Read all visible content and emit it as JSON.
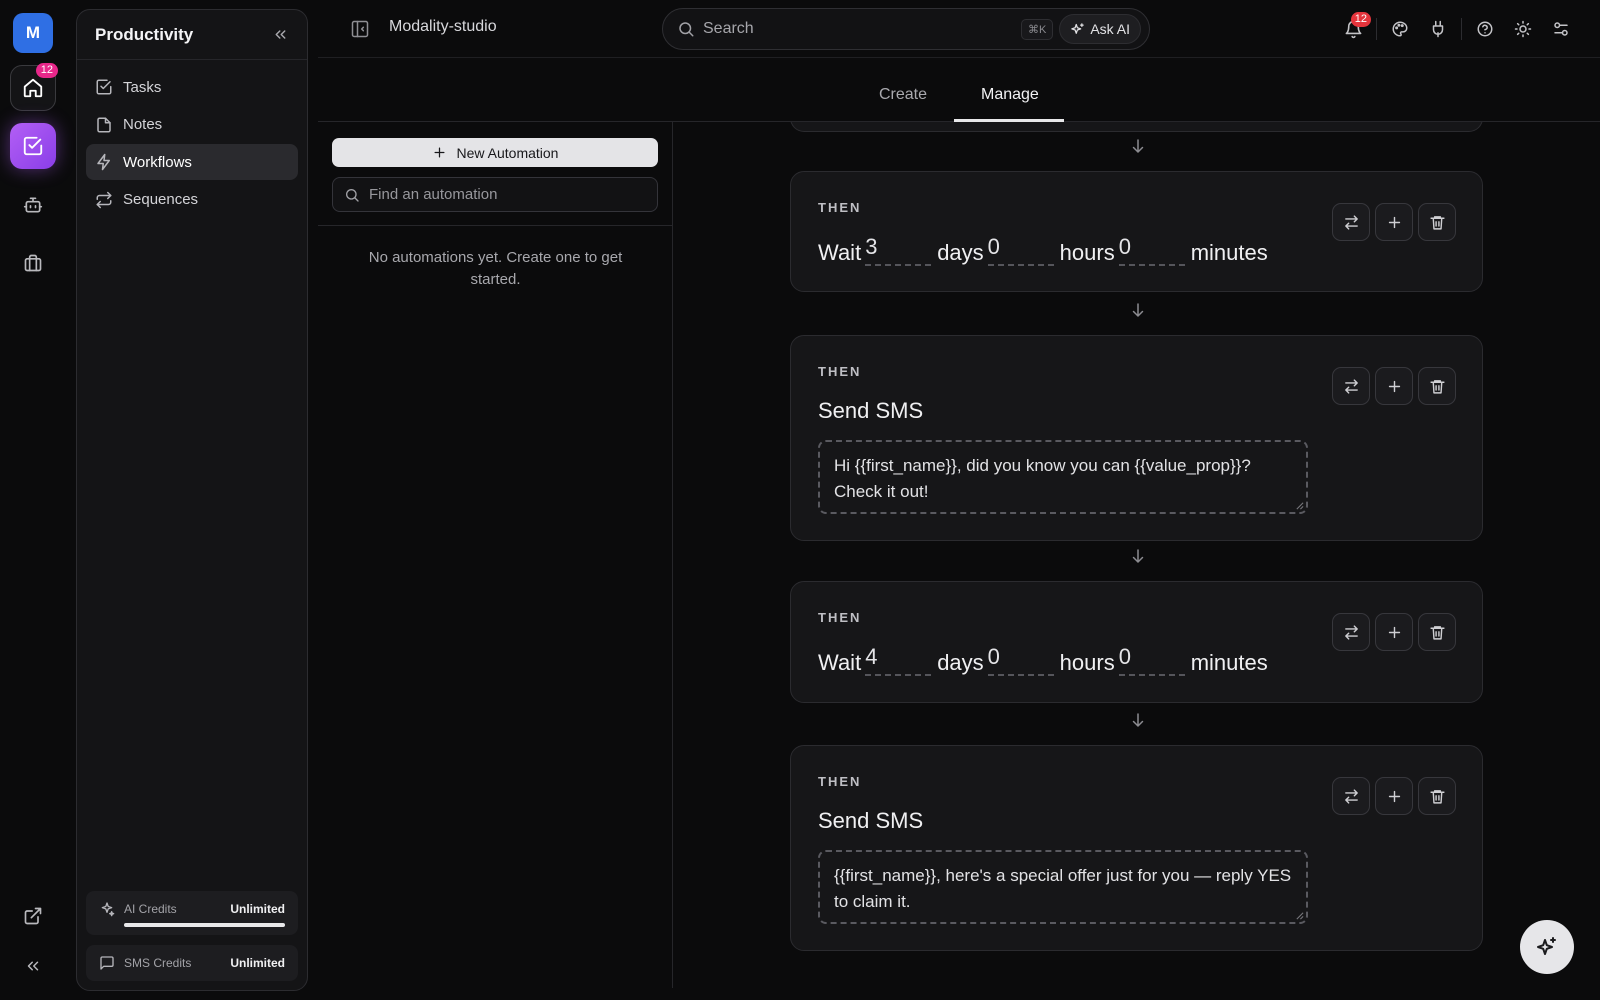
{
  "rail": {
    "avatar_initial": "M",
    "home_badge": "12"
  },
  "sidebar": {
    "title": "Productivity",
    "items": [
      {
        "label": "Tasks",
        "icon": "checkbox-icon"
      },
      {
        "label": "Notes",
        "icon": "file-icon"
      },
      {
        "label": "Workflows",
        "icon": "bolt-icon",
        "active": true
      },
      {
        "label": "Sequences",
        "icon": "repeat-icon"
      }
    ],
    "credits": {
      "ai_label": "AI Credits",
      "ai_value": "Unlimited",
      "ai_fill_percent": 100,
      "sms_label": "SMS Credits",
      "sms_value": "Unlimited"
    }
  },
  "topbar": {
    "workspace": "Modality-studio",
    "search_placeholder": "Search",
    "shortcut": "⌘K",
    "ask_ai": "Ask AI",
    "notification_count": "12"
  },
  "tabs": {
    "create": "Create",
    "manage": "Manage"
  },
  "automations": {
    "new_button": "New Automation",
    "find_placeholder": "Find an automation",
    "empty_message": "No automations yet. Create one to get started."
  },
  "steps": [
    {
      "type": "wait",
      "then": "THEN",
      "label": "Wait",
      "days": "3",
      "hours": "0",
      "minutes": "0",
      "days_unit": "days",
      "hours_unit": "hours",
      "minutes_unit": "minutes"
    },
    {
      "type": "sms",
      "then": "THEN",
      "title": "Send SMS",
      "message": "Hi {{first_name}}, did you know you can {{value_prop}}? Check it out!"
    },
    {
      "type": "wait",
      "then": "THEN",
      "label": "Wait",
      "days": "4",
      "hours": "0",
      "minutes": "0",
      "days_unit": "days",
      "hours_unit": "hours",
      "minutes_unit": "minutes"
    },
    {
      "type": "sms",
      "then": "THEN",
      "title": "Send SMS",
      "message": "{{first_name}}, here's a special offer just for you — reply YES to claim it."
    }
  ]
}
